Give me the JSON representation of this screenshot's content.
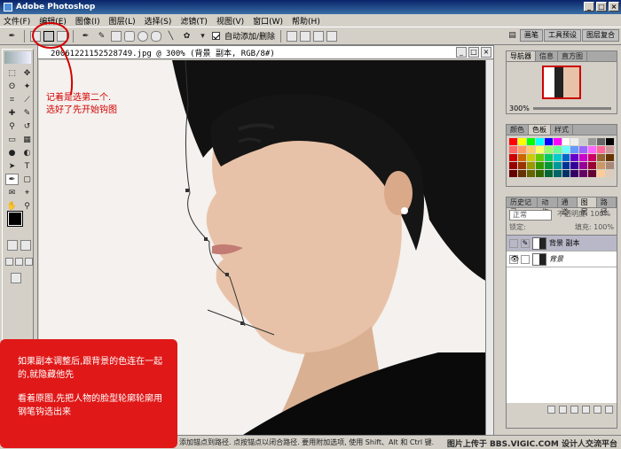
{
  "window": {
    "title": "Adobe Photoshop"
  },
  "menu": [
    "文件(F)",
    "编辑(E)",
    "图像(I)",
    "图层(L)",
    "选择(S)",
    "滤镜(T)",
    "视图(V)",
    "窗口(W)",
    "帮助(H)"
  ],
  "options": {
    "auto_add_delete": "自动添加/删除"
  },
  "palette_well": [
    "画笔",
    "工具预设",
    "图层复合"
  ],
  "document": {
    "title": "20061221152528749.jpg @ 300% (背景 副本, RGB/8#)"
  },
  "annotations": {
    "note1_line1": "记着是选第二个.",
    "note1_line2": "选好了先开始钩图",
    "box_para1": "如果副本调整后,跟背景的色连在一起的,就隐藏他先",
    "box_para2": "看着原图,先把人物的脸型轮廓轮廓用钢笔钩选出来"
  },
  "navigator": {
    "tabs": [
      "导航器",
      "信息",
      "直方图"
    ],
    "zoom": "300%"
  },
  "color_panel": {
    "tabs": [
      "颜色",
      "色板",
      "样式"
    ]
  },
  "layers_panel": {
    "tabs": [
      "历史记录",
      "动作",
      "通道",
      "图层",
      "路径"
    ],
    "blend_mode": "正常",
    "opacity_label": "不透明度: 100%",
    "lock_label": "锁定:",
    "fill_label": "填充: 100%",
    "layers": [
      {
        "name": "背景 副本",
        "selected": true
      },
      {
        "name": "背景",
        "selected": false
      }
    ]
  },
  "status": {
    "text": "添加锚点到路径. 点按锚点以闭合路径. 要用附加选项, 使用 Shift、Alt 和 Ctrl 键."
  },
  "watermark": "图片上传于 BBS.VIGIC.COM 设计人交流平台",
  "colors": {
    "red_annotation": "#d40000",
    "red_box": "#e01818"
  }
}
